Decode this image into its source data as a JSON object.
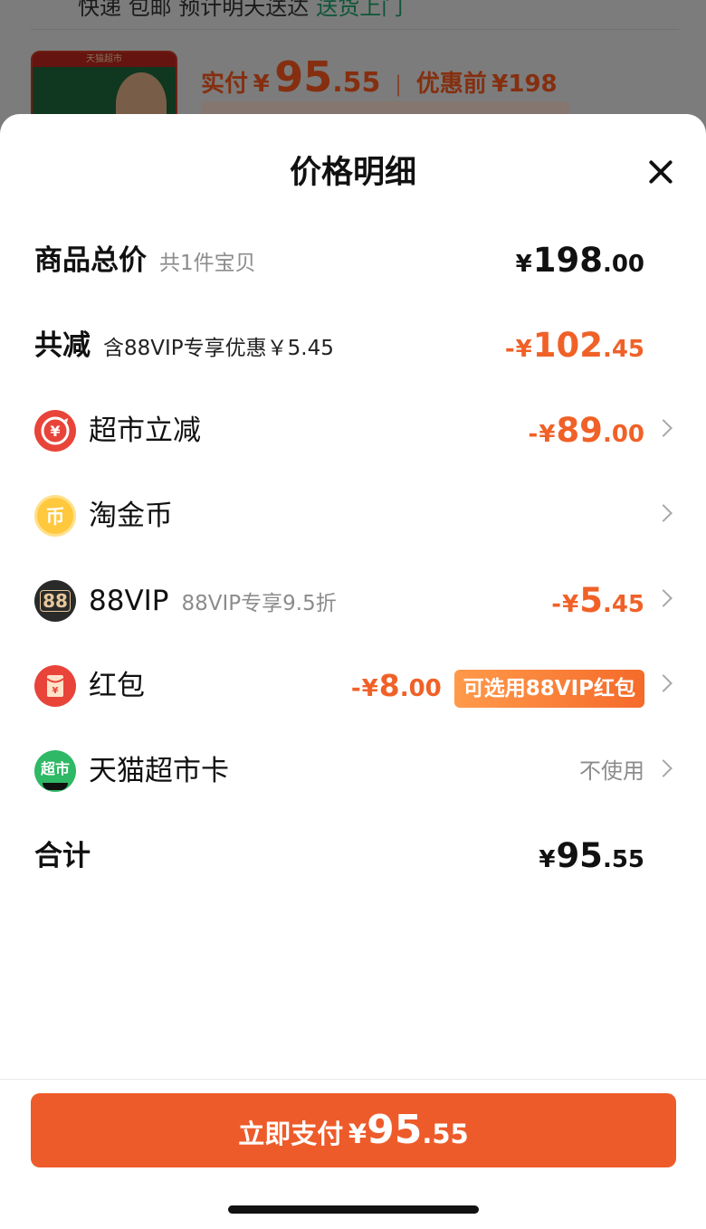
{
  "background": {
    "shipping_text": "快递 包邮 预计明天送达",
    "shipping_link": "送货上门",
    "thumb_label": "天猫超市",
    "price_label": "实付",
    "price_currency": "¥",
    "price_big": "95",
    "price_small": ".55",
    "orig_label": "优惠前",
    "orig_price": "¥198"
  },
  "sheet": {
    "title": "价格明细",
    "total_goods": {
      "label": "商品总价",
      "sub": "共1件宝贝",
      "currency": "¥",
      "big": "198",
      "small": ".00"
    },
    "total_discount": {
      "label": "共减",
      "sub": "含88VIP专享优惠￥5.45",
      "prefix": "-",
      "currency": "¥",
      "big": "102",
      "small": ".45"
    },
    "supermarket_discount": {
      "label": "超市立减",
      "icon": "yen-discount-icon",
      "prefix": "-",
      "currency": "¥",
      "big": "89",
      "small": ".00"
    },
    "coins": {
      "label": "淘金币",
      "icon": "coin-icon",
      "icon_char": "币"
    },
    "vip": {
      "label": "88VIP",
      "sub": "88VIP专享9.5折",
      "icon": "88vip-icon",
      "icon_char": "88",
      "prefix": "-",
      "currency": "¥",
      "big": "5",
      "small": ".45"
    },
    "red_packet": {
      "label": "红包",
      "icon": "red-packet-icon",
      "prefix": "-",
      "currency": "¥",
      "big": "8",
      "small": ".00",
      "badge": "可选用88VIP红包"
    },
    "tmall_card": {
      "label": "天猫超市卡",
      "icon": "tmall-card-icon",
      "icon_char": "超市",
      "value": "不使用"
    },
    "sum": {
      "label": "合计",
      "currency": "¥",
      "big": "95",
      "small": ".55"
    }
  },
  "pay_button": {
    "label": "立即支付",
    "currency": "¥",
    "big": "95",
    "small": ".55"
  },
  "colors": {
    "accent": "#ee5b2a",
    "discount": "#f06128",
    "vip_dark": "#2a2a2a"
  }
}
